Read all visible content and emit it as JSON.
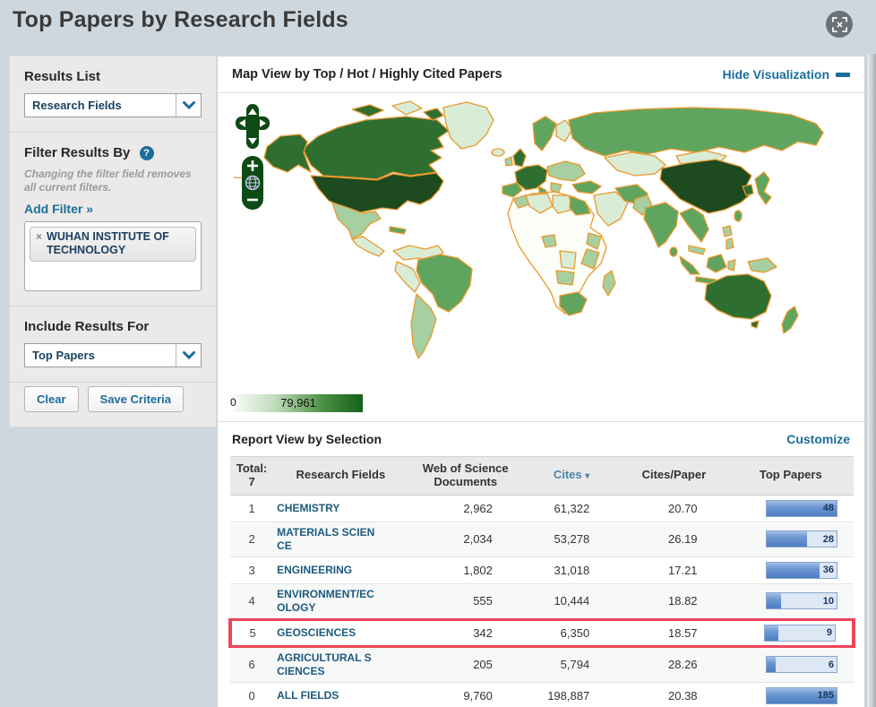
{
  "colors": {
    "accent_blue": "#1b6e9c",
    "field_link": "#1d5a7d",
    "highlight_red": "#ee4558",
    "bar_fill": "#4d7ec2",
    "map_border_orange": "#e9992c",
    "map_max_green": "#1d4a1f",
    "page_background": "#cfd7de"
  },
  "header": {
    "title": "Top Papers by Research Fields"
  },
  "sidebar": {
    "results_list": {
      "heading": "Results List",
      "value": "Research Fields"
    },
    "filter": {
      "heading": "Filter Results By",
      "help": "?",
      "note": "Changing the filter field removes all current filters.",
      "add_filter": "Add Filter »",
      "tag_remove": "×",
      "tag": "WUHAN INSTITUTE OF TECHNOLOGY"
    },
    "include": {
      "heading": "Include Results For",
      "value": "Top Papers"
    },
    "actions": {
      "clear": "Clear",
      "save": "Save Criteria"
    }
  },
  "map": {
    "heading": "Map View by Top / Hot / Highly Cited Papers",
    "hide": "Hide Visualization",
    "zoom_in": "+",
    "zoom_out": "−",
    "legend_min": "0",
    "legend_max": "79,961"
  },
  "report": {
    "heading": "Report View by Selection",
    "customize": "Customize",
    "columns": {
      "total": "Total:",
      "total_value": "7",
      "fields": "Research Fields",
      "documents": "Web of Science Documents",
      "cites": "Cites",
      "sort_caret": "▾",
      "cites_per_paper": "Cites/Paper",
      "top_papers": "Top Papers"
    },
    "rows": [
      {
        "rank": "1",
        "field": "CHEMISTRY",
        "docs": "2,962",
        "cites": "61,322",
        "cites_per_paper": "20.70",
        "top_papers": "48",
        "bar_pct": 100,
        "highlight": false
      },
      {
        "rank": "2",
        "field": "MATERIALS SCIENCE",
        "docs": "2,034",
        "cites": "53,278",
        "cites_per_paper": "26.19",
        "top_papers": "28",
        "bar_pct": 58,
        "highlight": false
      },
      {
        "rank": "3",
        "field": "ENGINEERING",
        "docs": "1,802",
        "cites": "31,018",
        "cites_per_paper": "17.21",
        "top_papers": "36",
        "bar_pct": 75,
        "highlight": false
      },
      {
        "rank": "4",
        "field": "ENVIRONMENT/ECOLOGY",
        "docs": "555",
        "cites": "10,444",
        "cites_per_paper": "18.82",
        "top_papers": "10",
        "bar_pct": 21,
        "highlight": false
      },
      {
        "rank": "5",
        "field": "GEOSCIENCES",
        "docs": "342",
        "cites": "6,350",
        "cites_per_paper": "18.57",
        "top_papers": "9",
        "bar_pct": 19,
        "highlight": true
      },
      {
        "rank": "6",
        "field": "AGRICULTURAL SCIENCES",
        "docs": "205",
        "cites": "5,794",
        "cites_per_paper": "28.26",
        "top_papers": "6",
        "bar_pct": 13,
        "highlight": false
      },
      {
        "rank": "0",
        "field": "ALL FIELDS",
        "docs": "9,760",
        "cites": "198,887",
        "cites_per_paper": "20.38",
        "top_papers": "185",
        "bar_pct": 100,
        "highlight": false
      }
    ]
  }
}
